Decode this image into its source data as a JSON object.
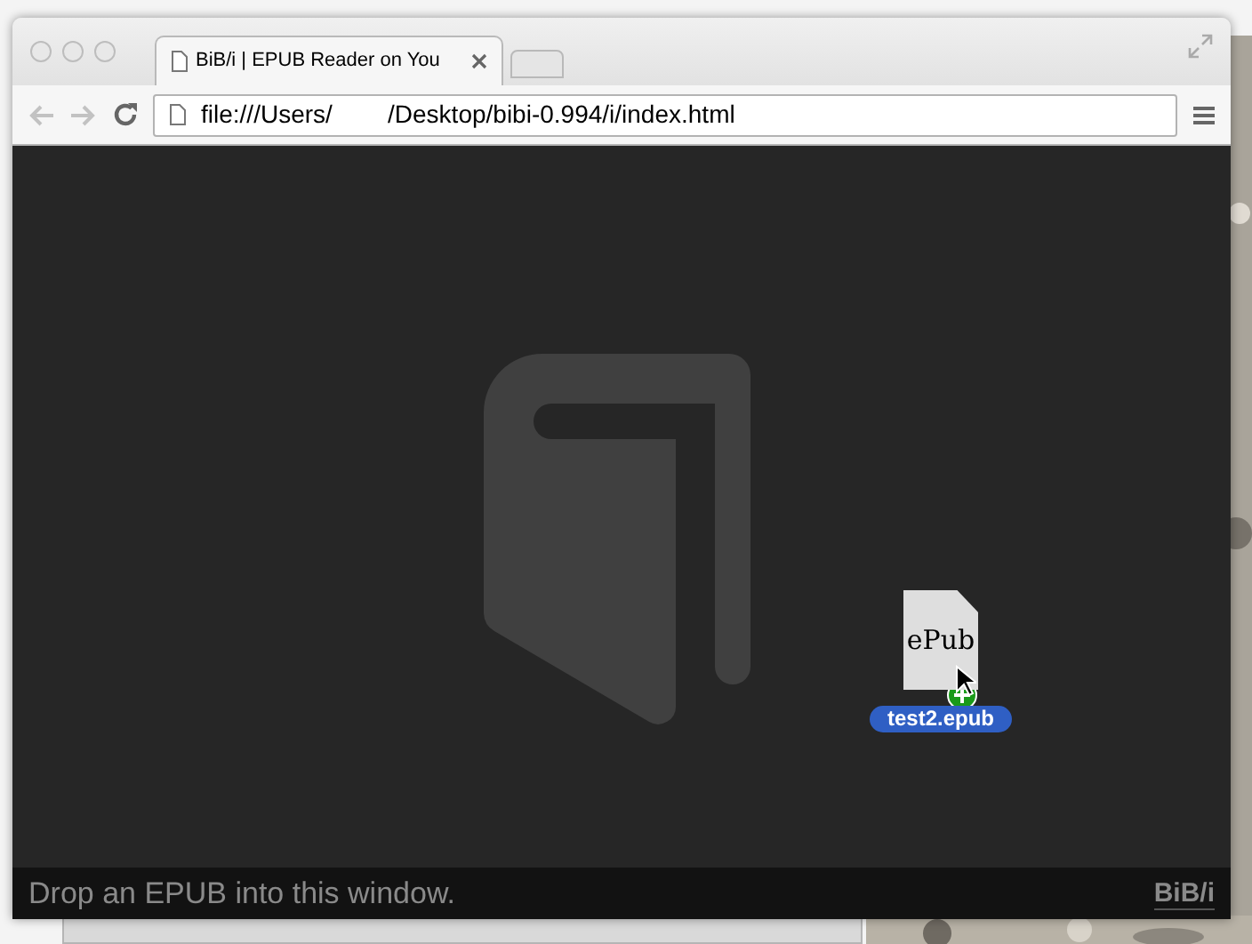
{
  "browser": {
    "tabs": [
      {
        "title": "BiB/i | EPUB Reader on You",
        "selected": true
      }
    ],
    "address": "file:///Users/        /Desktop/bibi-0.994/i/index.html"
  },
  "dragged_file": {
    "icon_text": "ePub",
    "name": "test2.epub"
  },
  "footer": {
    "message": "Drop an EPUB into this window.",
    "logo": "BiB/i"
  }
}
